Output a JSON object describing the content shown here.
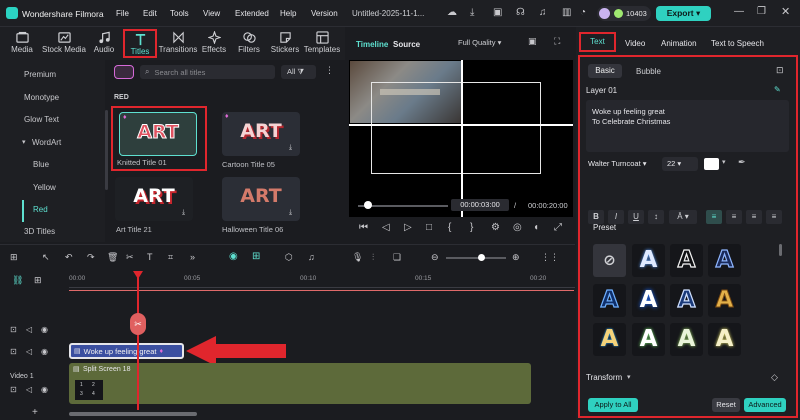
{
  "app": {
    "title": "Wondershare Filmora",
    "project": "Untitled-2025-11-1...",
    "credits": "10403",
    "export_label": "Export"
  },
  "menu": [
    "File",
    "Edit",
    "Tools",
    "View",
    "Extended",
    "Help",
    "Version"
  ],
  "toolbar": [
    {
      "label": "Media",
      "icon": "media-icon"
    },
    {
      "label": "Stock Media",
      "icon": "stock-media-icon"
    },
    {
      "label": "Audio",
      "icon": "audio-icon"
    },
    {
      "label": "Titles",
      "icon": "titles-icon",
      "active": true
    },
    {
      "label": "Transitions",
      "icon": "transitions-icon"
    },
    {
      "label": "Effects",
      "icon": "effects-icon"
    },
    {
      "label": "Filters",
      "icon": "filters-icon"
    },
    {
      "label": "Stickers",
      "icon": "stickers-icon"
    },
    {
      "label": "Templates",
      "icon": "templates-icon"
    }
  ],
  "categories": [
    "Premium",
    "Monotype",
    "Glow Text",
    "WordArt",
    "Blue",
    "Yellow",
    "Red",
    "3D Titles"
  ],
  "assets": {
    "search_placeholder": "Search all titles",
    "filter": "All",
    "section": "RED",
    "items": [
      {
        "art": "ART",
        "name": "Knitted Title 01"
      },
      {
        "art": "ART",
        "name": "Cartoon Title 05"
      },
      {
        "art": "ART",
        "name": "Art Title 21"
      },
      {
        "art": "ART",
        "name": "Halloween Title 06"
      }
    ]
  },
  "preview": {
    "tab_timeline": "Timeline",
    "tab_source": "Source",
    "quality": "Full Quality",
    "current_time": "00:00:03:00",
    "separator": "/",
    "total_time": "00:00:20:00"
  },
  "right_panel": {
    "tabs": [
      "Text",
      "Video",
      "Animation",
      "Text to Speech"
    ],
    "subtabs": [
      "Basic",
      "Bubble"
    ],
    "layer": "Layer 01",
    "text_line1": "Woke up feeling great",
    "text_line2": "To Celebrate Christmas",
    "font": "Walter Turncoat",
    "size": "22",
    "preset_label": "Preset",
    "transform_label": "Transform",
    "apply_all": "Apply to All",
    "reset": "Reset",
    "advanced": "Advanced",
    "colors": {
      "accent": "#5ee0d0",
      "highlight": "#e0262d"
    }
  },
  "timeline": {
    "ruler": [
      "00:00",
      "00:05",
      "00:10",
      "00:15",
      "00:20"
    ],
    "title_clip": "Woke up feeling great",
    "video_clip": "Split Screen 18",
    "video_track": "Video 1",
    "thumb_nums": [
      "1",
      "2",
      "3",
      "4"
    ]
  }
}
